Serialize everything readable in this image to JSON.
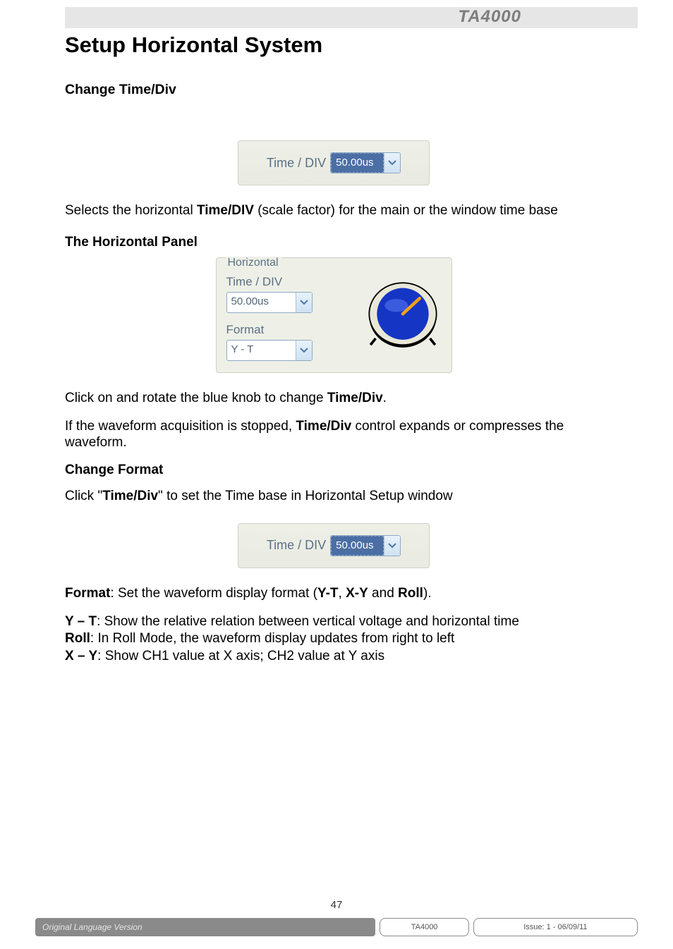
{
  "brand": "TA4000",
  "section_title": "Setup Horizontal System",
  "change_time_div_heading": "Change Time/Div",
  "timediv_widget": {
    "label": "Time / DIV",
    "value": "50.00us"
  },
  "selects_paragraph_prefix": "Selects the horizontal ",
  "selects_paragraph_bold": "Time/DIV",
  "selects_paragraph_suffix": " (scale factor) for the main or the window time base",
  "horizontal_panel_heading": "The Horizontal Panel",
  "hpanel": {
    "legend": "Horizontal",
    "time_div_label": "Time / DIV",
    "time_div_value": "50.00us",
    "format_label": "Format",
    "format_value": "Y - T"
  },
  "rotate_para_prefix": "Click on and rotate the blue knob to change ",
  "rotate_para_bold": "Time/Div",
  "rotate_para_suffix": ".",
  "stopped_para_prefix": "If the waveform acquisition is stopped, ",
  "stopped_para_bold": "Time/Div",
  "stopped_para_suffix": " control expands or compresses the waveform.",
  "change_format_heading": "Change Format",
  "click_para_prefix": "Click \"",
  "click_para_bold": "Time/Div",
  "click_para_suffix": "\" to set the Time base in Horizontal Setup window",
  "format_line_prefix": "Format",
  "format_line_mid1": ": Set the waveform display format (",
  "format_y_t": "Y-T",
  "format_sep1": ", ",
  "format_x_y": "X-Y",
  "format_sep2": " and ",
  "format_roll": "Roll",
  "format_line_suffix": ").",
  "yt_bold": "Y – T",
  "yt_text": ": Show the relative relation between vertical voltage and horizontal time",
  "roll_bold": "Roll",
  "roll_text": ": In Roll Mode, the waveform display updates from right to left",
  "xy_bold": "X – Y",
  "xy_text": ": Show CH1 value at X axis; CH2 value at Y axis",
  "page_number": "47",
  "footer_left": "Original Language Version",
  "footer_mid": "TA4000",
  "footer_right": "Issue: 1 - 06/09/11"
}
